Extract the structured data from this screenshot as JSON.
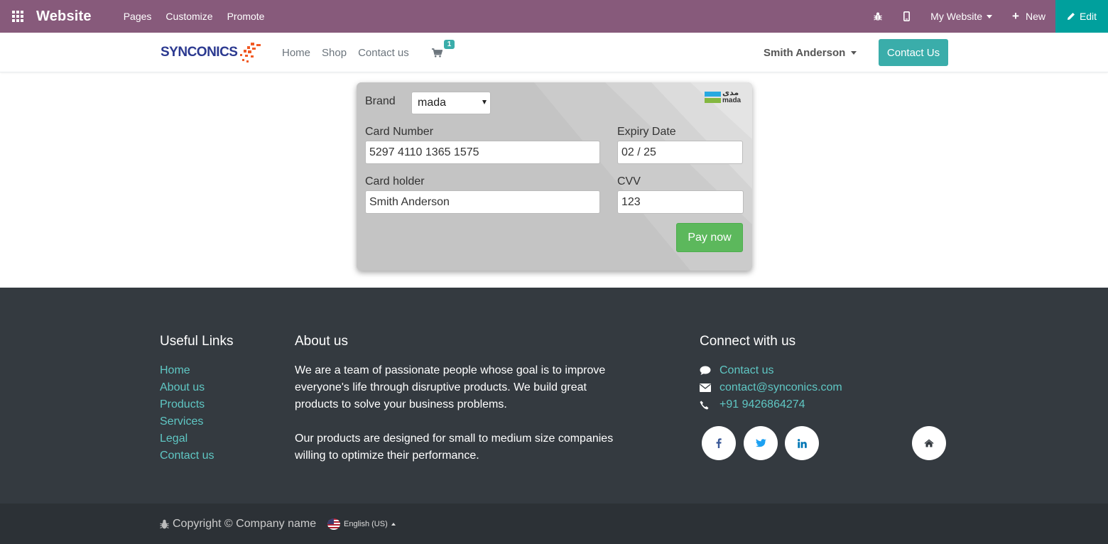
{
  "adminbar": {
    "title": "Website",
    "menu": [
      "Pages",
      "Customize",
      "Promote"
    ],
    "site_selector": "My Website",
    "new_label": "New",
    "edit_label": "Edit",
    "icons": [
      "apps-icon",
      "bug-icon",
      "mobile-icon",
      "plus-icon",
      "pencil-icon"
    ]
  },
  "header": {
    "logo_text": "SYNCONICS",
    "nav": [
      "Home",
      "Shop",
      "Contact us"
    ],
    "cart_count": "1",
    "user_name": "Smith Anderson",
    "contact_button": "Contact Us"
  },
  "payment": {
    "brand_label": "Brand",
    "brand_value": "mada",
    "card_number_label": "Card Number",
    "card_number_value": "5297 4110 1365 1575",
    "expiry_label": "Expiry Date",
    "expiry_value": "02 / 25",
    "holder_label": "Card holder",
    "holder_value": "Smith Anderson",
    "cvv_label": "CVV",
    "cvv_value": "123",
    "pay_button": "Pay now",
    "logo_arabic": "مدى",
    "logo_latin": "mada"
  },
  "footer": {
    "useful_links_title": "Useful Links",
    "useful_links": [
      "Home",
      "About us",
      "Products",
      "Services",
      "Legal",
      "Contact us"
    ],
    "about_title": "About us",
    "about_p1": "We are a team of passionate people whose goal is to improve everyone's life through disruptive products. We build great products to solve your business problems.",
    "about_p2": "Our products are designed for small to medium size companies willing to optimize their performance.",
    "connect_title": "Connect with us",
    "connect": {
      "contact": "Contact us",
      "email": "contact@synconics.com",
      "phone": "+91 9426864274"
    },
    "social_icons": [
      "facebook-icon",
      "twitter-icon",
      "linkedin-icon",
      "home-icon"
    ]
  },
  "copyright": {
    "text": "Copyright © Company name",
    "language": "English (US)"
  },
  "colors": {
    "admin_bar": "#875a7b",
    "edit_button": "#00a09d",
    "primary": "#3aadaa",
    "pay_button": "#5cb85c",
    "footer_bg": "#343a40",
    "footer_link": "#5fc7c4"
  }
}
